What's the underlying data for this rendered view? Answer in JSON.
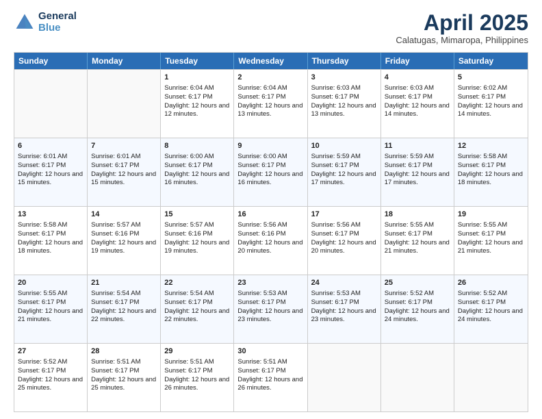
{
  "header": {
    "logo_line1": "General",
    "logo_line2": "Blue",
    "month_title": "April 2025",
    "location": "Calatugas, Mimaropa, Philippines"
  },
  "weekdays": [
    "Sunday",
    "Monday",
    "Tuesday",
    "Wednesday",
    "Thursday",
    "Friday",
    "Saturday"
  ],
  "weeks": [
    [
      {
        "day": "",
        "sunrise": "",
        "sunset": "",
        "daylight": ""
      },
      {
        "day": "",
        "sunrise": "",
        "sunset": "",
        "daylight": ""
      },
      {
        "day": "1",
        "sunrise": "Sunrise: 6:04 AM",
        "sunset": "Sunset: 6:17 PM",
        "daylight": "Daylight: 12 hours and 12 minutes."
      },
      {
        "day": "2",
        "sunrise": "Sunrise: 6:04 AM",
        "sunset": "Sunset: 6:17 PM",
        "daylight": "Daylight: 12 hours and 13 minutes."
      },
      {
        "day": "3",
        "sunrise": "Sunrise: 6:03 AM",
        "sunset": "Sunset: 6:17 PM",
        "daylight": "Daylight: 12 hours and 13 minutes."
      },
      {
        "day": "4",
        "sunrise": "Sunrise: 6:03 AM",
        "sunset": "Sunset: 6:17 PM",
        "daylight": "Daylight: 12 hours and 14 minutes."
      },
      {
        "day": "5",
        "sunrise": "Sunrise: 6:02 AM",
        "sunset": "Sunset: 6:17 PM",
        "daylight": "Daylight: 12 hours and 14 minutes."
      }
    ],
    [
      {
        "day": "6",
        "sunrise": "Sunrise: 6:01 AM",
        "sunset": "Sunset: 6:17 PM",
        "daylight": "Daylight: 12 hours and 15 minutes."
      },
      {
        "day": "7",
        "sunrise": "Sunrise: 6:01 AM",
        "sunset": "Sunset: 6:17 PM",
        "daylight": "Daylight: 12 hours and 15 minutes."
      },
      {
        "day": "8",
        "sunrise": "Sunrise: 6:00 AM",
        "sunset": "Sunset: 6:17 PM",
        "daylight": "Daylight: 12 hours and 16 minutes."
      },
      {
        "day": "9",
        "sunrise": "Sunrise: 6:00 AM",
        "sunset": "Sunset: 6:17 PM",
        "daylight": "Daylight: 12 hours and 16 minutes."
      },
      {
        "day": "10",
        "sunrise": "Sunrise: 5:59 AM",
        "sunset": "Sunset: 6:17 PM",
        "daylight": "Daylight: 12 hours and 17 minutes."
      },
      {
        "day": "11",
        "sunrise": "Sunrise: 5:59 AM",
        "sunset": "Sunset: 6:17 PM",
        "daylight": "Daylight: 12 hours and 17 minutes."
      },
      {
        "day": "12",
        "sunrise": "Sunrise: 5:58 AM",
        "sunset": "Sunset: 6:17 PM",
        "daylight": "Daylight: 12 hours and 18 minutes."
      }
    ],
    [
      {
        "day": "13",
        "sunrise": "Sunrise: 5:58 AM",
        "sunset": "Sunset: 6:17 PM",
        "daylight": "Daylight: 12 hours and 18 minutes."
      },
      {
        "day": "14",
        "sunrise": "Sunrise: 5:57 AM",
        "sunset": "Sunset: 6:16 PM",
        "daylight": "Daylight: 12 hours and 19 minutes."
      },
      {
        "day": "15",
        "sunrise": "Sunrise: 5:57 AM",
        "sunset": "Sunset: 6:16 PM",
        "daylight": "Daylight: 12 hours and 19 minutes."
      },
      {
        "day": "16",
        "sunrise": "Sunrise: 5:56 AM",
        "sunset": "Sunset: 6:16 PM",
        "daylight": "Daylight: 12 hours and 20 minutes."
      },
      {
        "day": "17",
        "sunrise": "Sunrise: 5:56 AM",
        "sunset": "Sunset: 6:17 PM",
        "daylight": "Daylight: 12 hours and 20 minutes."
      },
      {
        "day": "18",
        "sunrise": "Sunrise: 5:55 AM",
        "sunset": "Sunset: 6:17 PM",
        "daylight": "Daylight: 12 hours and 21 minutes."
      },
      {
        "day": "19",
        "sunrise": "Sunrise: 5:55 AM",
        "sunset": "Sunset: 6:17 PM",
        "daylight": "Daylight: 12 hours and 21 minutes."
      }
    ],
    [
      {
        "day": "20",
        "sunrise": "Sunrise: 5:55 AM",
        "sunset": "Sunset: 6:17 PM",
        "daylight": "Daylight: 12 hours and 21 minutes."
      },
      {
        "day": "21",
        "sunrise": "Sunrise: 5:54 AM",
        "sunset": "Sunset: 6:17 PM",
        "daylight": "Daylight: 12 hours and 22 minutes."
      },
      {
        "day": "22",
        "sunrise": "Sunrise: 5:54 AM",
        "sunset": "Sunset: 6:17 PM",
        "daylight": "Daylight: 12 hours and 22 minutes."
      },
      {
        "day": "23",
        "sunrise": "Sunrise: 5:53 AM",
        "sunset": "Sunset: 6:17 PM",
        "daylight": "Daylight: 12 hours and 23 minutes."
      },
      {
        "day": "24",
        "sunrise": "Sunrise: 5:53 AM",
        "sunset": "Sunset: 6:17 PM",
        "daylight": "Daylight: 12 hours and 23 minutes."
      },
      {
        "day": "25",
        "sunrise": "Sunrise: 5:52 AM",
        "sunset": "Sunset: 6:17 PM",
        "daylight": "Daylight: 12 hours and 24 minutes."
      },
      {
        "day": "26",
        "sunrise": "Sunrise: 5:52 AM",
        "sunset": "Sunset: 6:17 PM",
        "daylight": "Daylight: 12 hours and 24 minutes."
      }
    ],
    [
      {
        "day": "27",
        "sunrise": "Sunrise: 5:52 AM",
        "sunset": "Sunset: 6:17 PM",
        "daylight": "Daylight: 12 hours and 25 minutes."
      },
      {
        "day": "28",
        "sunrise": "Sunrise: 5:51 AM",
        "sunset": "Sunset: 6:17 PM",
        "daylight": "Daylight: 12 hours and 25 minutes."
      },
      {
        "day": "29",
        "sunrise": "Sunrise: 5:51 AM",
        "sunset": "Sunset: 6:17 PM",
        "daylight": "Daylight: 12 hours and 26 minutes."
      },
      {
        "day": "30",
        "sunrise": "Sunrise: 5:51 AM",
        "sunset": "Sunset: 6:17 PM",
        "daylight": "Daylight: 12 hours and 26 minutes."
      },
      {
        "day": "",
        "sunrise": "",
        "sunset": "",
        "daylight": ""
      },
      {
        "day": "",
        "sunrise": "",
        "sunset": "",
        "daylight": ""
      },
      {
        "day": "",
        "sunrise": "",
        "sunset": "",
        "daylight": ""
      }
    ]
  ]
}
